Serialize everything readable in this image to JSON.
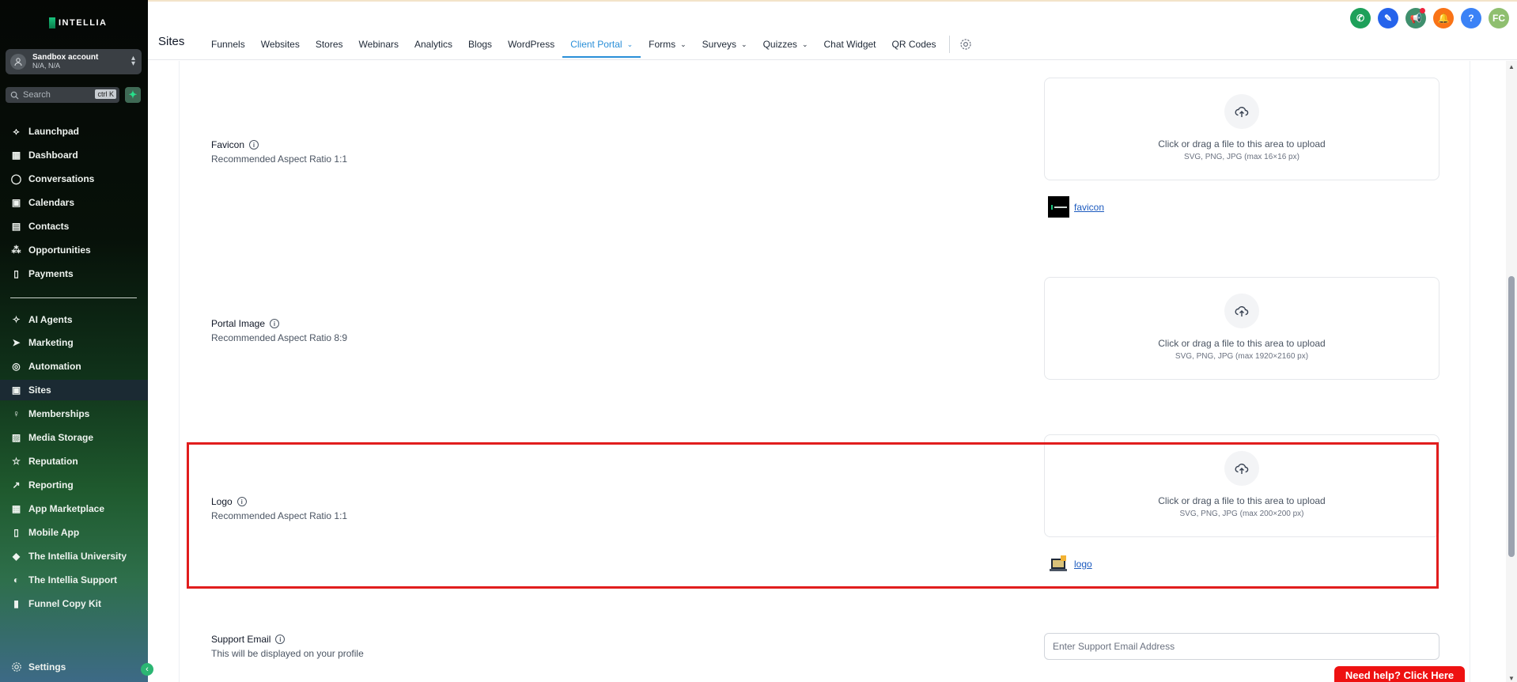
{
  "brand": {
    "name": "INTELLIA"
  },
  "account": {
    "name": "Sandbox account",
    "location": "N/A, N/A"
  },
  "search": {
    "placeholder": "Search",
    "shortcut": "ctrl K"
  },
  "sidebar": {
    "items": [
      {
        "label": "Launchpad",
        "icon": "rocket-icon"
      },
      {
        "label": "Dashboard",
        "icon": "grid-icon"
      },
      {
        "label": "Conversations",
        "icon": "chat-icon"
      },
      {
        "label": "Calendars",
        "icon": "calendar-icon"
      },
      {
        "label": "Contacts",
        "icon": "contacts-icon"
      },
      {
        "label": "Opportunities",
        "icon": "pipeline-icon"
      },
      {
        "label": "Payments",
        "icon": "receipt-icon"
      },
      {
        "label": "AI Agents",
        "icon": "sparkle-icon"
      },
      {
        "label": "Marketing",
        "icon": "send-icon"
      },
      {
        "label": "Automation",
        "icon": "automation-icon"
      },
      {
        "label": "Sites",
        "icon": "sites-icon",
        "active": true
      },
      {
        "label": "Memberships",
        "icon": "membership-icon"
      },
      {
        "label": "Media Storage",
        "icon": "image-icon"
      },
      {
        "label": "Reputation",
        "icon": "star-icon"
      },
      {
        "label": "Reporting",
        "icon": "trend-icon"
      },
      {
        "label": "App Marketplace",
        "icon": "apps-icon"
      },
      {
        "label": "Mobile App",
        "icon": "mobile-icon"
      },
      {
        "label": "The Intellia University",
        "icon": "graduation-cap-icon"
      },
      {
        "label": "The Intellia Support",
        "icon": "headset-icon"
      },
      {
        "label": "Funnel Copy Kit",
        "icon": "document-icon"
      }
    ],
    "settings_label": "Settings"
  },
  "header": {
    "title": "Sites",
    "tabs": [
      {
        "label": "Funnels"
      },
      {
        "label": "Websites"
      },
      {
        "label": "Stores"
      },
      {
        "label": "Webinars"
      },
      {
        "label": "Analytics"
      },
      {
        "label": "Blogs"
      },
      {
        "label": "WordPress"
      },
      {
        "label": "Client Portal",
        "active": true,
        "dropdown": true
      },
      {
        "label": "Forms",
        "dropdown": true
      },
      {
        "label": "Surveys",
        "dropdown": true
      },
      {
        "label": "Quizzes",
        "dropdown": true
      },
      {
        "label": "Chat Widget"
      },
      {
        "label": "QR Codes"
      }
    ],
    "top_icons": [
      {
        "name": "phone-icon",
        "color": "#1ea05a"
      },
      {
        "name": "magic-icon",
        "color": "#2563eb"
      },
      {
        "name": "megaphone-icon",
        "color": "#3f8f6d"
      },
      {
        "name": "bell-icon",
        "color": "#f97316"
      },
      {
        "name": "help-icon",
        "color": "#3b82f6",
        "text": "?"
      },
      {
        "name": "avatar",
        "color": "#8fbf6f",
        "text": "FC"
      }
    ]
  },
  "settings": {
    "favicon": {
      "label": "Favicon",
      "hint": "Recommended Aspect Ratio 1:1",
      "upload_text": "Click or drag a file to this area to upload",
      "formats": "SVG, PNG, JPG (max 16×16 px)",
      "file_name": "favicon"
    },
    "portal_image": {
      "label": "Portal Image",
      "hint": "Recommended Aspect Ratio 8:9",
      "upload_text": "Click or drag a file to this area to upload",
      "formats": "SVG, PNG, JPG (max 1920×2160 px)"
    },
    "logo": {
      "label": "Logo",
      "hint": "Recommended Aspect Ratio 1:1",
      "upload_text": "Click or drag a file to this area to upload",
      "formats": "SVG, PNG, JPG (max 200×200 px)",
      "file_name": "logo"
    },
    "support_email": {
      "label": "Support Email",
      "hint": "This will be displayed on your profile",
      "placeholder": "Enter Support Email Address",
      "value": ""
    }
  },
  "help_button": {
    "label": "Need help? Click Here"
  },
  "colors": {
    "accent": "#2a8fd8",
    "highlight": "#e11d1d",
    "help": "#ee1111"
  }
}
